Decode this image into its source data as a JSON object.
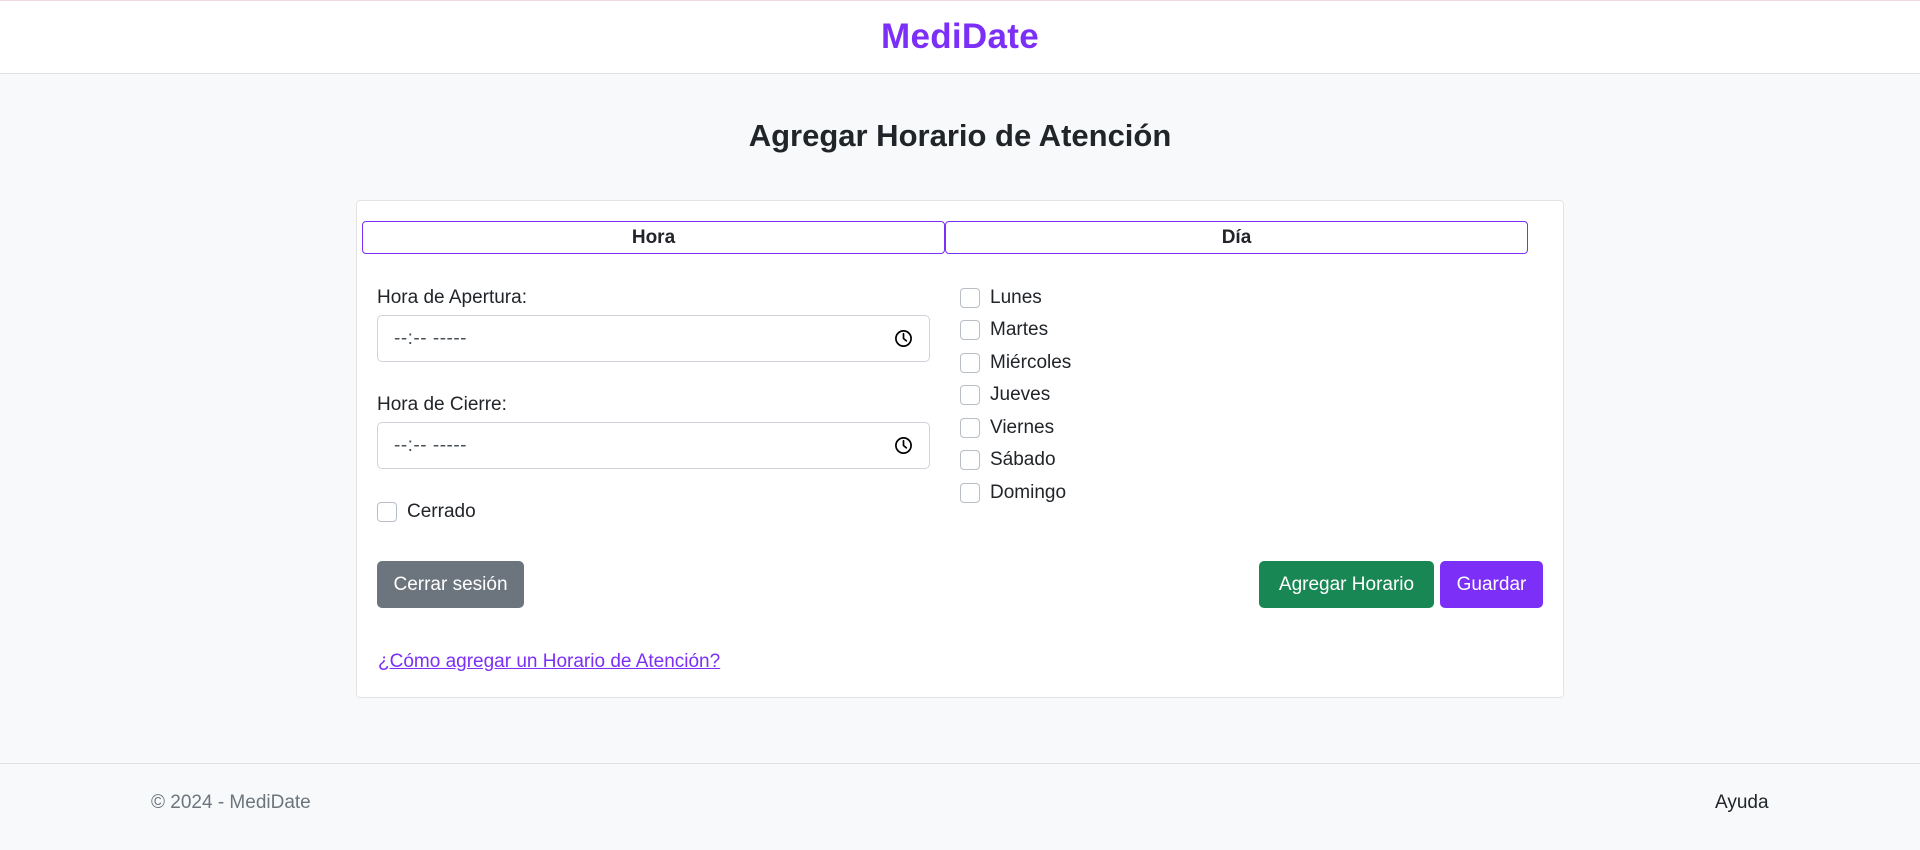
{
  "header": {
    "brand": "MediDate"
  },
  "page": {
    "title": "Agregar Horario de Atención"
  },
  "form": {
    "hora_header": "Hora",
    "dia_header": "Día",
    "apertura_label": "Hora de Apertura:",
    "apertura_value": "--:-- -----",
    "cierre_label": "Hora de Cierre:",
    "cierre_value": "--:-- -----",
    "cerrado_label": "Cerrado",
    "days": [
      "Lunes",
      "Martes",
      "Miércoles",
      "Jueves",
      "Viernes",
      "Sábado",
      "Domingo"
    ]
  },
  "actions": {
    "logout": "Cerrar sesión",
    "add": "Agregar Horario",
    "save": "Guardar"
  },
  "help": {
    "link": "¿Cómo agregar un Horario de Atención?"
  },
  "footer": {
    "copyright": "© 2024 - MediDate",
    "help": "Ayuda"
  },
  "colors": {
    "brand": "#7b2ff7",
    "success": "#198754",
    "secondary": "#6c757d"
  },
  "icons": {
    "time": "clock-icon"
  }
}
